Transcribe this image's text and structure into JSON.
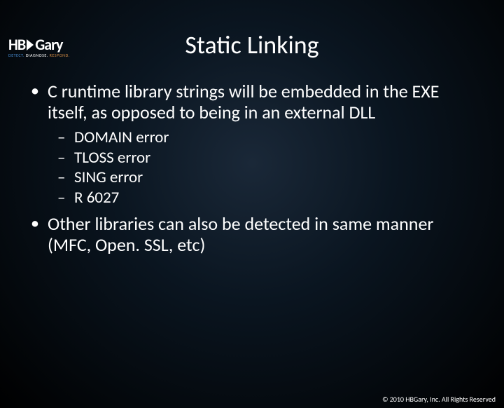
{
  "logo": {
    "hb": "HB",
    "gary": "Gary",
    "tagline_detect": "DETECT.",
    "tagline_diagnose": "DIAGNOSE.",
    "tagline_respond": "RESPOND."
  },
  "title": "Static Linking",
  "bullets": [
    {
      "text": "C runtime library strings will be embedded in the EXE itself, as opposed to being in an external DLL",
      "subs": [
        "DOMAIN error",
        "TLOSS error",
        "SING error",
        "R 6027"
      ]
    },
    {
      "text": "Other libraries can also be detected in same manner (MFC, Open. SSL, etc)",
      "subs": []
    }
  ],
  "footer": "© 2010 HBGary, Inc. All Rights Reserved"
}
